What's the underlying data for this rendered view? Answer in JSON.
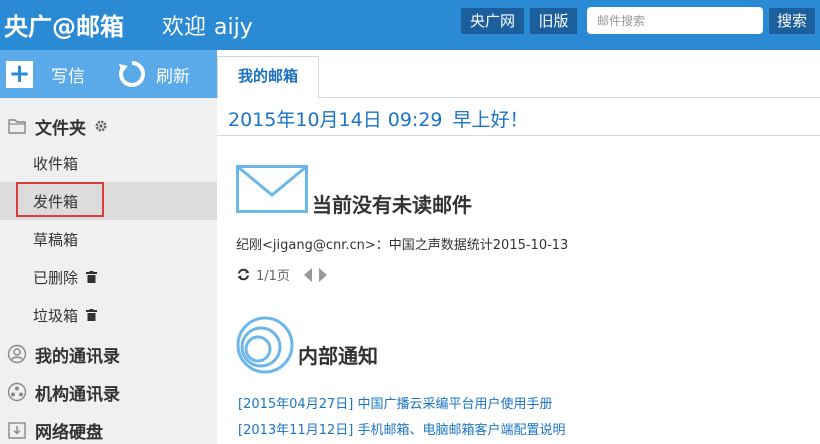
{
  "header": {
    "logo": "央广@邮箱",
    "welcome": "欢迎",
    "username": "aijy",
    "cnr_link": "央广网",
    "old_version": "旧版",
    "search_placeholder": "邮件搜索",
    "search_button": "搜索"
  },
  "toolbar": {
    "compose": "写信",
    "refresh": "刷新"
  },
  "sidebar": {
    "folders_title": "文件夹",
    "folders": [
      {
        "label": "收件箱"
      },
      {
        "label": "发件箱"
      },
      {
        "label": "草稿箱"
      },
      {
        "label": "已删除"
      },
      {
        "label": "垃圾箱"
      }
    ],
    "contacts": "我的通讯录",
    "org_contacts": "机构通讯录",
    "network_disk": "网络硬盘"
  },
  "tabs": [
    {
      "label": "我的邮箱"
    }
  ],
  "main": {
    "date": "2015年10月14日 09:29",
    "greeting": "早上好！",
    "unread_title": "当前没有未读邮件",
    "recent_mail": "纪刚<jigang@cnr.cn>：中国之声数据统计2015-10-13",
    "pager": "1/1页",
    "notice_title": "内部通知",
    "notices": [
      {
        "text": "[2015年04月27日] 中国广播云采编平台用户使用手册"
      },
      {
        "text": "[2013年11月12日] 手机邮箱、电脑邮箱客户端配置说明"
      }
    ]
  },
  "colors": {
    "header_bg": "#2a8ad4",
    "toolbar_bg": "#5aa9e8",
    "accent_blue": "#1a75c6",
    "highlight_red": "#e03b3b"
  }
}
